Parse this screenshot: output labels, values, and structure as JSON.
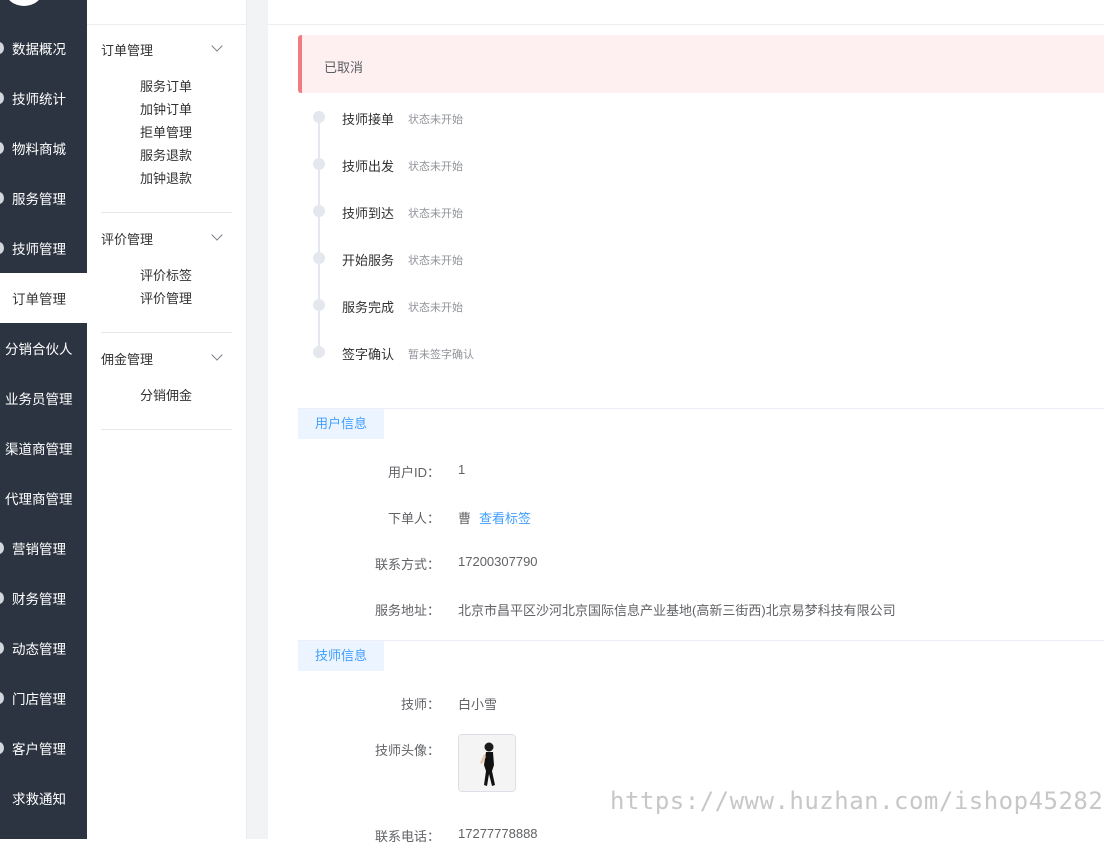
{
  "sidebar": {
    "items": [
      {
        "label": "数据概况"
      },
      {
        "label": "技师统计"
      },
      {
        "label": "物料商城"
      },
      {
        "label": "服务管理"
      },
      {
        "label": "技师管理"
      },
      {
        "label": "订单管理"
      },
      {
        "label": "分销合伙人"
      },
      {
        "label": "业务员管理"
      },
      {
        "label": "渠道商管理"
      },
      {
        "label": "代理商管理"
      },
      {
        "label": "营销管理"
      },
      {
        "label": "财务管理"
      },
      {
        "label": "动态管理"
      },
      {
        "label": "门店管理"
      },
      {
        "label": "客户管理"
      },
      {
        "label": "求救通知"
      }
    ],
    "active": "订单管理"
  },
  "subnav": {
    "groups": [
      {
        "title": "订单管理",
        "items": [
          "服务订单",
          "加钟订单",
          "拒单管理",
          "服务退款",
          "加钟退款"
        ]
      },
      {
        "title": "评价管理",
        "items": [
          "评价标签",
          "评价管理"
        ]
      },
      {
        "title": "佣金管理",
        "items": [
          "分销佣金"
        ]
      }
    ]
  },
  "order_status": {
    "alert": "已取消"
  },
  "timeline": [
    {
      "title": "技师接单",
      "status": "状态未开始"
    },
    {
      "title": "技师出发",
      "status": "状态未开始"
    },
    {
      "title": "技师到达",
      "status": "状态未开始"
    },
    {
      "title": "开始服务",
      "status": "状态未开始"
    },
    {
      "title": "服务完成",
      "status": "状态未开始"
    },
    {
      "title": "签字确认",
      "status": "暂未签字确认"
    }
  ],
  "user_info": {
    "section_title": "用户信息",
    "user_id_label": "用户ID：",
    "user_id": "1",
    "orderer_label": "下单人：",
    "orderer": "曹",
    "view_tags_link": "查看标签",
    "contact_label": "联系方式：",
    "contact": "17200307790",
    "address_label": "服务地址：",
    "address": "北京市昌平区沙河北京国际信息产业基地(高新三街西)北京易梦科技有限公司"
  },
  "tech_info": {
    "section_title": "技师信息",
    "tech_label": "技师：",
    "tech_name": "白小雪",
    "avatar_label": "技师头像：",
    "phone_label": "联系电话：",
    "phone": "17277778888"
  },
  "watermark": "https://www.huzhan.com/ishop45282",
  "colors": {
    "sidebar_bg": "#2b3440",
    "accent": "#409eff",
    "alert_bg": "#fef0f0",
    "alert_border": "#f07c82"
  }
}
